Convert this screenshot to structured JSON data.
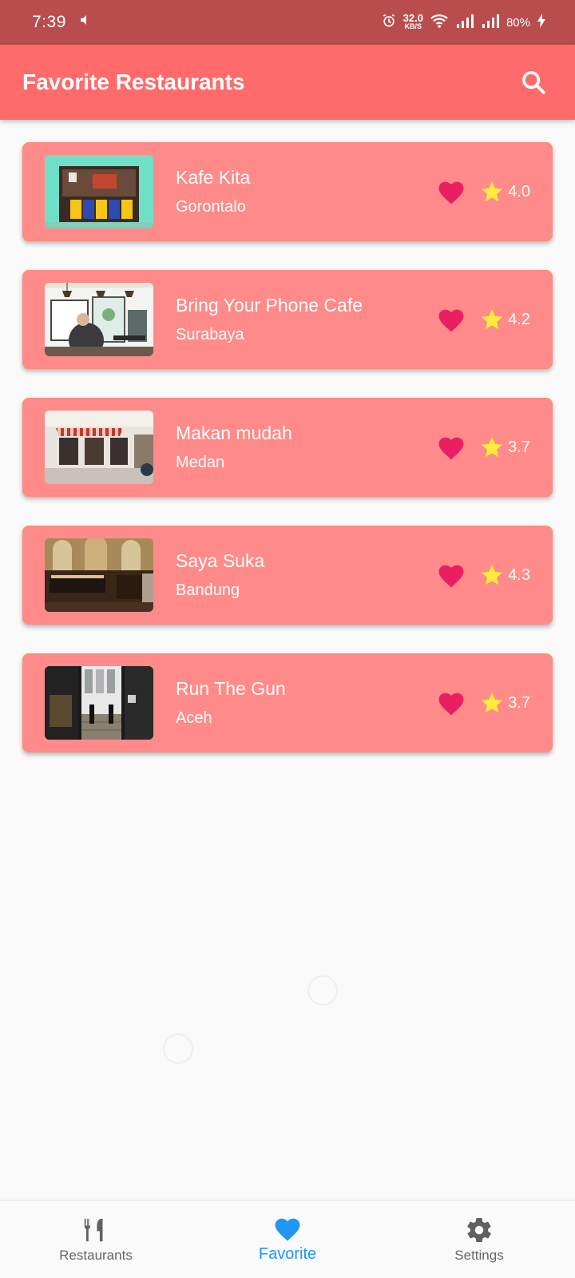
{
  "status_bar": {
    "time": "7:39",
    "net_speed_value": "32.0",
    "net_speed_unit": "KB/S",
    "battery": "80%"
  },
  "app_bar": {
    "title": "Favorite Restaurants"
  },
  "restaurants": [
    {
      "name": "Kafe Kita",
      "city": "Gorontalo",
      "rating": "4.0"
    },
    {
      "name": "Bring Your Phone Cafe",
      "city": "Surabaya",
      "rating": "4.2"
    },
    {
      "name": "Makan mudah",
      "city": "Medan",
      "rating": "3.7"
    },
    {
      "name": "Saya Suka",
      "city": "Bandung",
      "rating": "4.3"
    },
    {
      "name": "Run The Gun",
      "city": "Aceh",
      "rating": "3.7"
    }
  ],
  "bottom_nav": {
    "items": [
      {
        "label": "Restaurants",
        "icon": "restaurant-icon"
      },
      {
        "label": "Favorite",
        "icon": "heart-icon",
        "active": true
      },
      {
        "label": "Settings",
        "icon": "gear-icon"
      }
    ]
  },
  "colors": {
    "status_bar": "#b94d4d",
    "app_bar": "#ff6b6b",
    "card": "#ff8a8a",
    "heart": "#e91e63",
    "star": "#ffeb3b",
    "active_nav": "#2196f3"
  }
}
